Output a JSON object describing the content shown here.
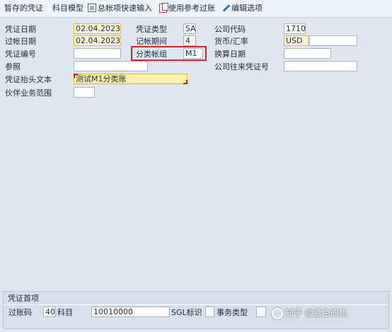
{
  "toolbar": {
    "items": [
      {
        "label": "暂存的凭证"
      },
      {
        "label": "科目模型"
      },
      {
        "label": "总帐项快速输入"
      },
      {
        "label": "使用参考过账"
      },
      {
        "label": "编辑选项"
      }
    ]
  },
  "header_form": {
    "doc_date": {
      "label": "凭证日期",
      "value": "02.04.2023"
    },
    "doc_type": {
      "label": "凭证类型",
      "value": "SA"
    },
    "company_code": {
      "label": "公司代码",
      "value": "1710"
    },
    "posting_date": {
      "label": "过帐日期",
      "value": "02.04.2023"
    },
    "period": {
      "label": "记帐期间",
      "value": "4"
    },
    "currency": {
      "label": "货币/汇率",
      "value": "USD",
      "rate": ""
    },
    "doc_number": {
      "label": "凭证编号",
      "value": ""
    },
    "ledger_group": {
      "label": "分类帐组",
      "value": "M1"
    },
    "translation_date": {
      "label": "换算日期",
      "value": ""
    },
    "reference": {
      "label": "参照",
      "value": ""
    },
    "intercompany_number": {
      "label": "公司往来凭证号",
      "value": ""
    },
    "header_text": {
      "label": "凭证抬头文本",
      "value": "测试M1分类账"
    },
    "trading_partner_ba": {
      "label": "伙伴业务范围",
      "value": ""
    }
  },
  "first_line_item": {
    "title": "凭证首项",
    "posting_key": {
      "label": "过账码",
      "value": "40"
    },
    "account": {
      "label": "科目",
      "value": "10010000"
    },
    "sgl_indicator": {
      "label": "SGL标识",
      "value": ""
    },
    "transaction_type": {
      "label": "事务类型",
      "value": ""
    }
  },
  "watermark": {
    "text": "知乎 @蓝色的鱼"
  },
  "colors": {
    "highlight": "#d8232a",
    "required_field": "#fff0a8",
    "background": "#dfe6ee"
  }
}
